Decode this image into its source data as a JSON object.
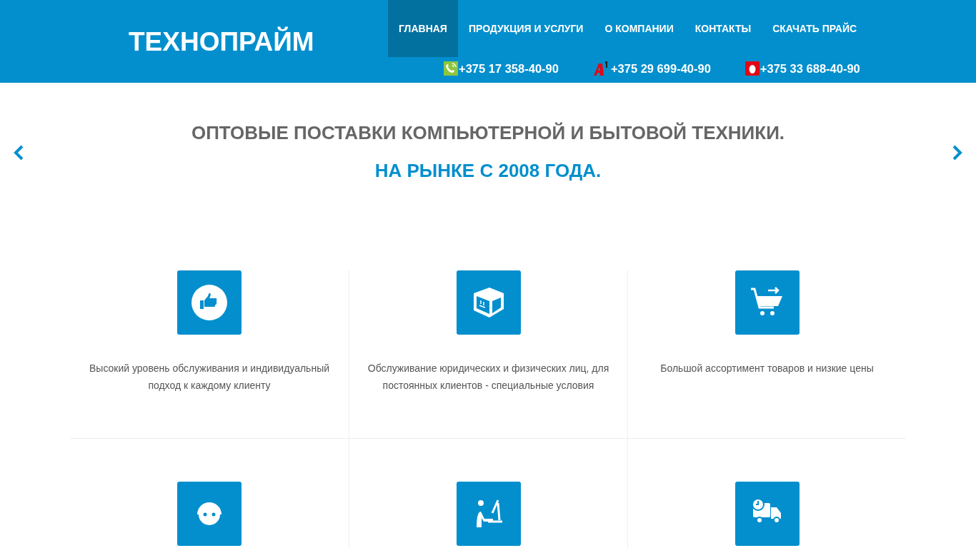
{
  "header": {
    "logo": "ТЕХНОПРАЙМ",
    "nav": [
      {
        "label": "ГЛАВНАЯ",
        "selected": true
      },
      {
        "label": "ПРОДУКЦИЯ И УСЛУГИ",
        "selected": false
      },
      {
        "label": "О КОМПАНИИ",
        "selected": false
      },
      {
        "label": "КОНТАКТЫ",
        "selected": false
      },
      {
        "label": "СКАЧАТЬ ПРАЙС",
        "selected": false
      }
    ],
    "phones": [
      {
        "kind": "landline",
        "number": "+375 17 358-40-90"
      },
      {
        "kind": "a1",
        "number": "+375 29 699-40-90"
      },
      {
        "kind": "mts",
        "number": "+375 33 688-40-90"
      }
    ]
  },
  "slider": {
    "headline": "ОПТОВЫЕ ПОСТАВКИ КОМПЬЮТЕРНОЙ И БЫТОВОЙ ТЕХНИКИ.",
    "subline": "НА РЫНКЕ С 2008 ГОДА."
  },
  "features": [
    {
      "kind": "thumbs-up",
      "text": "Высокий уровень обслуживания и индивидуальный подход к каждому клиенту"
    },
    {
      "kind": "box",
      "text": "Обслуживание юридических и физических лиц, для постоянных клиентов - специальные условия"
    },
    {
      "kind": "cart",
      "text": "Большой ассортимент товаров и низкие цены"
    },
    {
      "kind": "headset"
    },
    {
      "kind": "desk"
    },
    {
      "kind": "truck"
    }
  ]
}
